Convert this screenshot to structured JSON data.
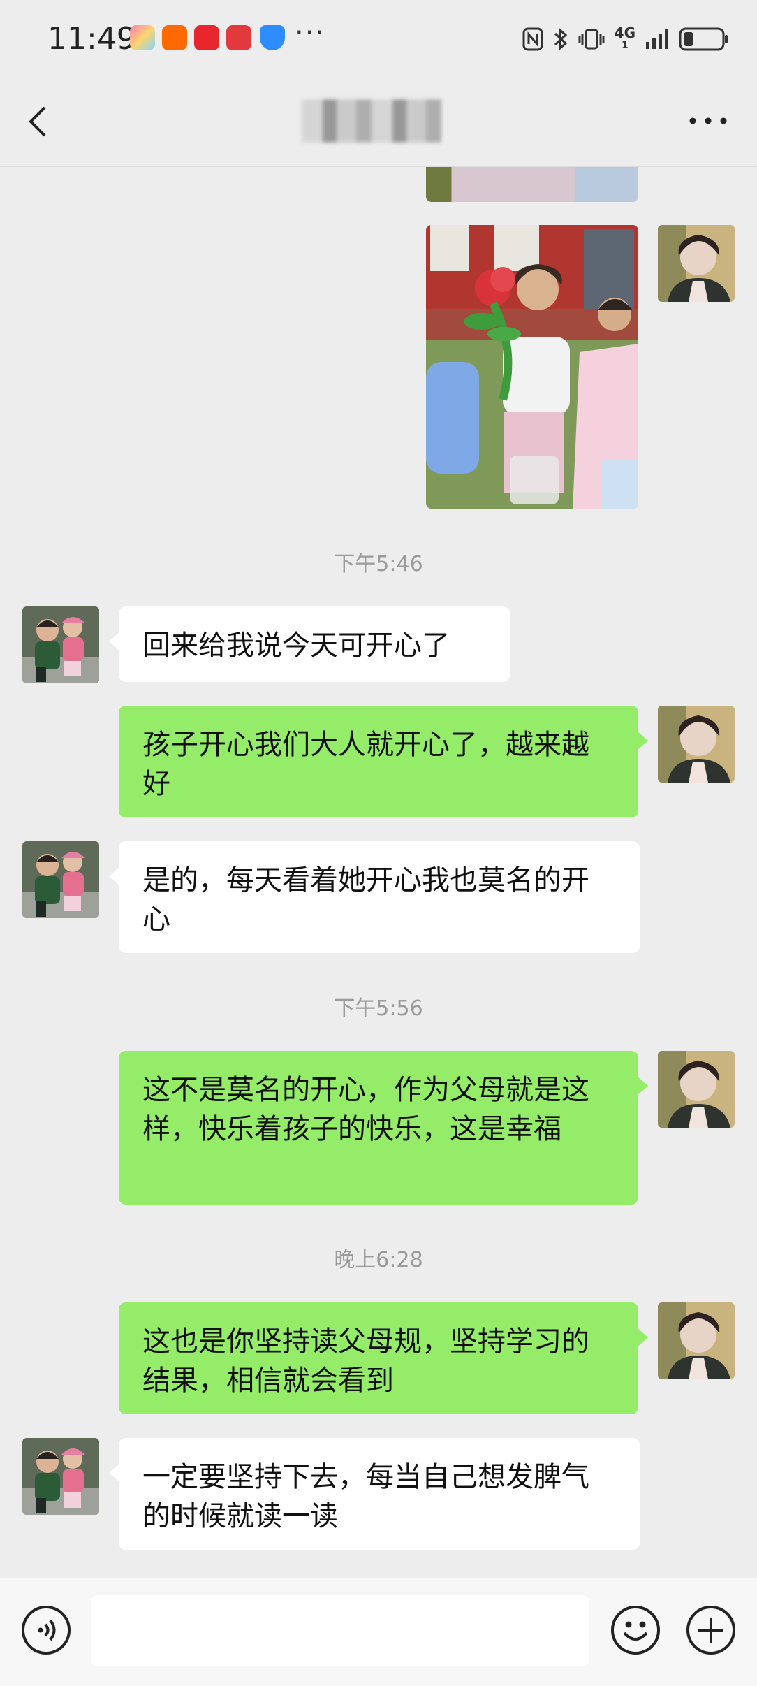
{
  "status_bar": {
    "time": "11:49",
    "network": "4G",
    "network_sub": "1",
    "overflow": "···"
  },
  "chat": {
    "timestamps": [
      "下午5:46",
      "下午5:56",
      "晚上6:28"
    ],
    "messages": [
      "回来给我说今天可开心了",
      "孩子开心我们大人就开心了，越来越好",
      "是的，每天看着她开心我也莫名的开心",
      "这不是莫名的开心，作为父母就是这样，快乐着孩子的快乐，这是幸福",
      "这也是你坚持读父母规，坚持学习的结果，相信就会看到",
      "一定要坚持下去，每当自己想发脾气的时候就读一读"
    ]
  },
  "colors": {
    "background": "#ededed",
    "bubble_sent": "#95ec69",
    "bubble_received": "#ffffff"
  }
}
